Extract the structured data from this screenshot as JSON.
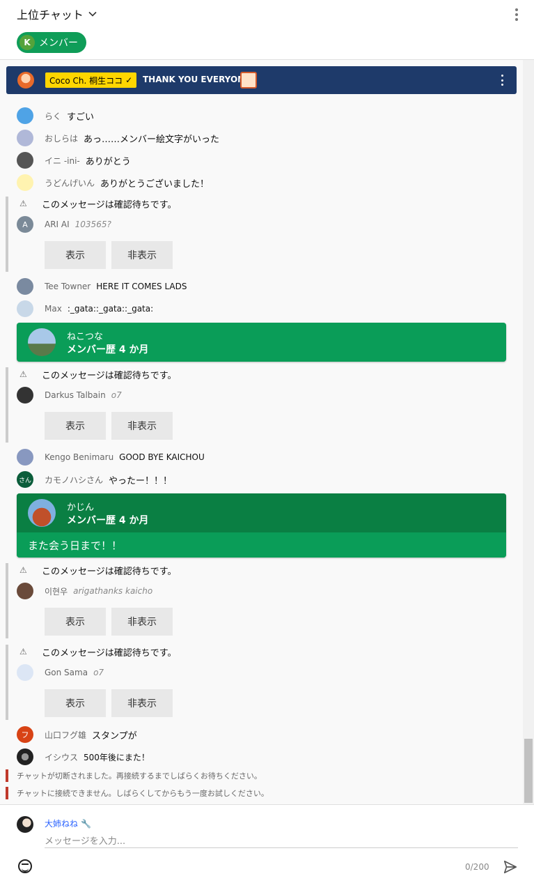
{
  "header": {
    "title": "上位チャット",
    "member_chip": {
      "initial": "K",
      "label": "メンバー"
    }
  },
  "pinned": {
    "author": "Coco Ch. 桐生ココ",
    "message": "THANK YOU EVERYONE"
  },
  "messages": [
    {
      "author": "らく",
      "text": "すごい"
    },
    {
      "author": "おしらは",
      "text": "あっ……メンバー絵文字がいった"
    },
    {
      "author": "イニ -ini-",
      "text": "ありがとう"
    },
    {
      "author": "うどんげいん",
      "text": "ありがとうございました！"
    },
    {
      "author": "Tee Towner",
      "text": "HERE IT COMES LADS"
    },
    {
      "author": "Max",
      "text": ":_gata::_gata::_gata:"
    },
    {
      "author": "Kengo Benimaru",
      "text": "GOOD BYE KAICHOU"
    },
    {
      "author": "カモノハシさん",
      "avatar_text": "さん",
      "text": "やったー！！！"
    },
    {
      "author": "山口フグ雄",
      "avatar_text": "フ",
      "text": "スタンプが"
    },
    {
      "author": "イシウス",
      "text": "500年後にまた！"
    }
  ],
  "held": {
    "notice": "このメッセージは確認待ちです。",
    "show_label": "表示",
    "hide_label": "非表示",
    "items": [
      {
        "author": "ARI AI",
        "avatar_text": "A",
        "text": "103565?"
      },
      {
        "author": "Darkus Talbain",
        "text": "o7"
      },
      {
        "author": "이현우",
        "text": "arigathanks kaicho"
      },
      {
        "author": "Gon Sama",
        "text": "o7"
      }
    ]
  },
  "memberships": [
    {
      "name": "ねこつな",
      "tenure": "メンバー歴 4 か月"
    },
    {
      "name": "かじん",
      "tenure": "メンバー歴 4 か月",
      "message": "また会う日まで！！"
    }
  ],
  "system": [
    "チャットが切断されました。再接続するまでしばらくお待ちください。",
    "チャットに接続できません。しばらくしてからもう一度お試しください。"
  ],
  "composer": {
    "user": "大姉ねね",
    "placeholder": "メッセージを入力...",
    "counter": "0/200"
  },
  "colors": {
    "member_green": "#0a9d58",
    "member_green_dark": "#0a7f43",
    "pinned_bg": "#1e3a6a",
    "owner_badge": "#ffd600",
    "error_bar": "#c0392b"
  }
}
